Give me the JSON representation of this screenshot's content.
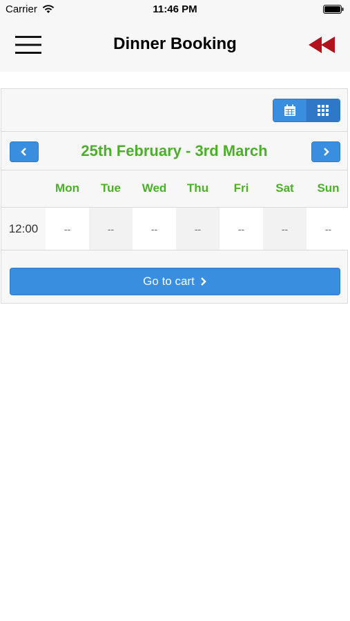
{
  "status_bar": {
    "carrier": "Carrier",
    "time": "11:46 PM"
  },
  "nav": {
    "title": "Dinner Booking",
    "menu_icon": "hamburger-menu-icon",
    "back_icon": "rewind-back-icon",
    "back_color": "#b0121e"
  },
  "booking": {
    "view_toggle": {
      "calendar_icon": "calendar-icon",
      "grid_icon": "grid-icon"
    },
    "week_label": "25th February - 3rd March",
    "days": [
      {
        "label": "Mon"
      },
      {
        "label": "Tue"
      },
      {
        "label": "Wed"
      },
      {
        "label": "Thu"
      },
      {
        "label": "Fri"
      },
      {
        "label": "Sat"
      },
      {
        "label": "Sun"
      }
    ],
    "slots": [
      {
        "time": "12:00",
        "cells": [
          "--",
          "--",
          "--",
          "--",
          "--",
          "--",
          "--"
        ]
      }
    ],
    "cart_label": "Go to cart"
  },
  "colors": {
    "accent_blue": "#3a8ee0",
    "day_green": "#4caf2a",
    "back_red": "#b0121e"
  }
}
